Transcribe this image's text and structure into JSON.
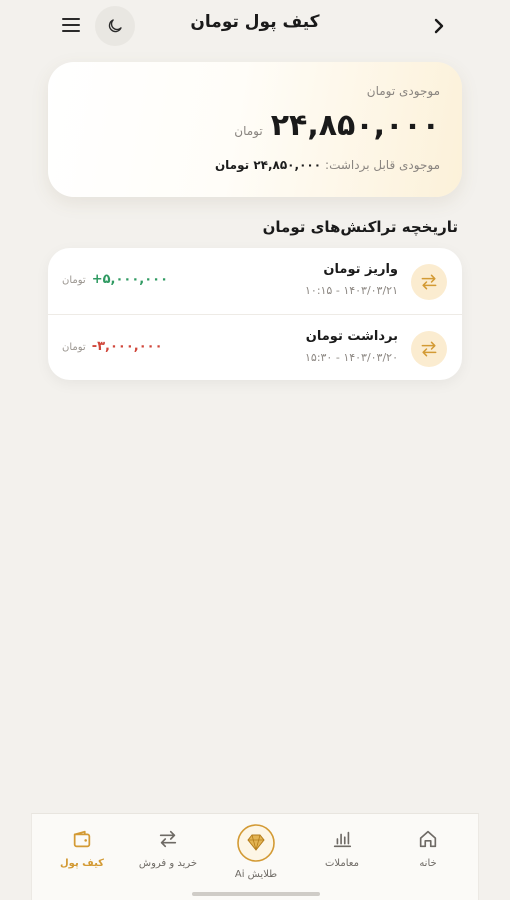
{
  "header": {
    "title": "کیف پول تومان",
    "menu_icon": "menu-icon",
    "theme_icon": "moon-icon",
    "back_icon": "chevron-right-icon"
  },
  "balance": {
    "label": "موجودی تومان",
    "amount": "۲۴,۸۵۰,۰۰۰",
    "unit": "تومان",
    "withdrawable_label": "موجودی قابل برداشت:",
    "withdrawable_value": "۲۴,۸۵۰,۰۰۰ تومان"
  },
  "history": {
    "title": "تاریخچه تراکنش‌های تومان",
    "transactions": [
      {
        "title": "واریز تومان",
        "date": "۱۴۰۳/۰۳/۲۱ - ۱۰:۱۵",
        "amount": "+۵,۰۰۰,۰۰۰",
        "unit": "تومان",
        "icon": "swap-icon"
      },
      {
        "title": "برداشت تومان",
        "date": "۱۴۰۳/۰۳/۲۰ - ۱۵:۳۰",
        "amount": "-۳,۰۰۰,۰۰۰",
        "unit": "تومان",
        "icon": "swap-icon"
      }
    ]
  },
  "nav": {
    "home": "خانه",
    "trades": "معاملات",
    "ai": "طلایش Ai",
    "buy_sell": "خرید و فروش",
    "wallet": "کیف پول"
  },
  "colors": {
    "accent": "#d39a34",
    "positive": "#2f9a62",
    "negative": "#d0463a",
    "background": "#f3f1ed"
  }
}
